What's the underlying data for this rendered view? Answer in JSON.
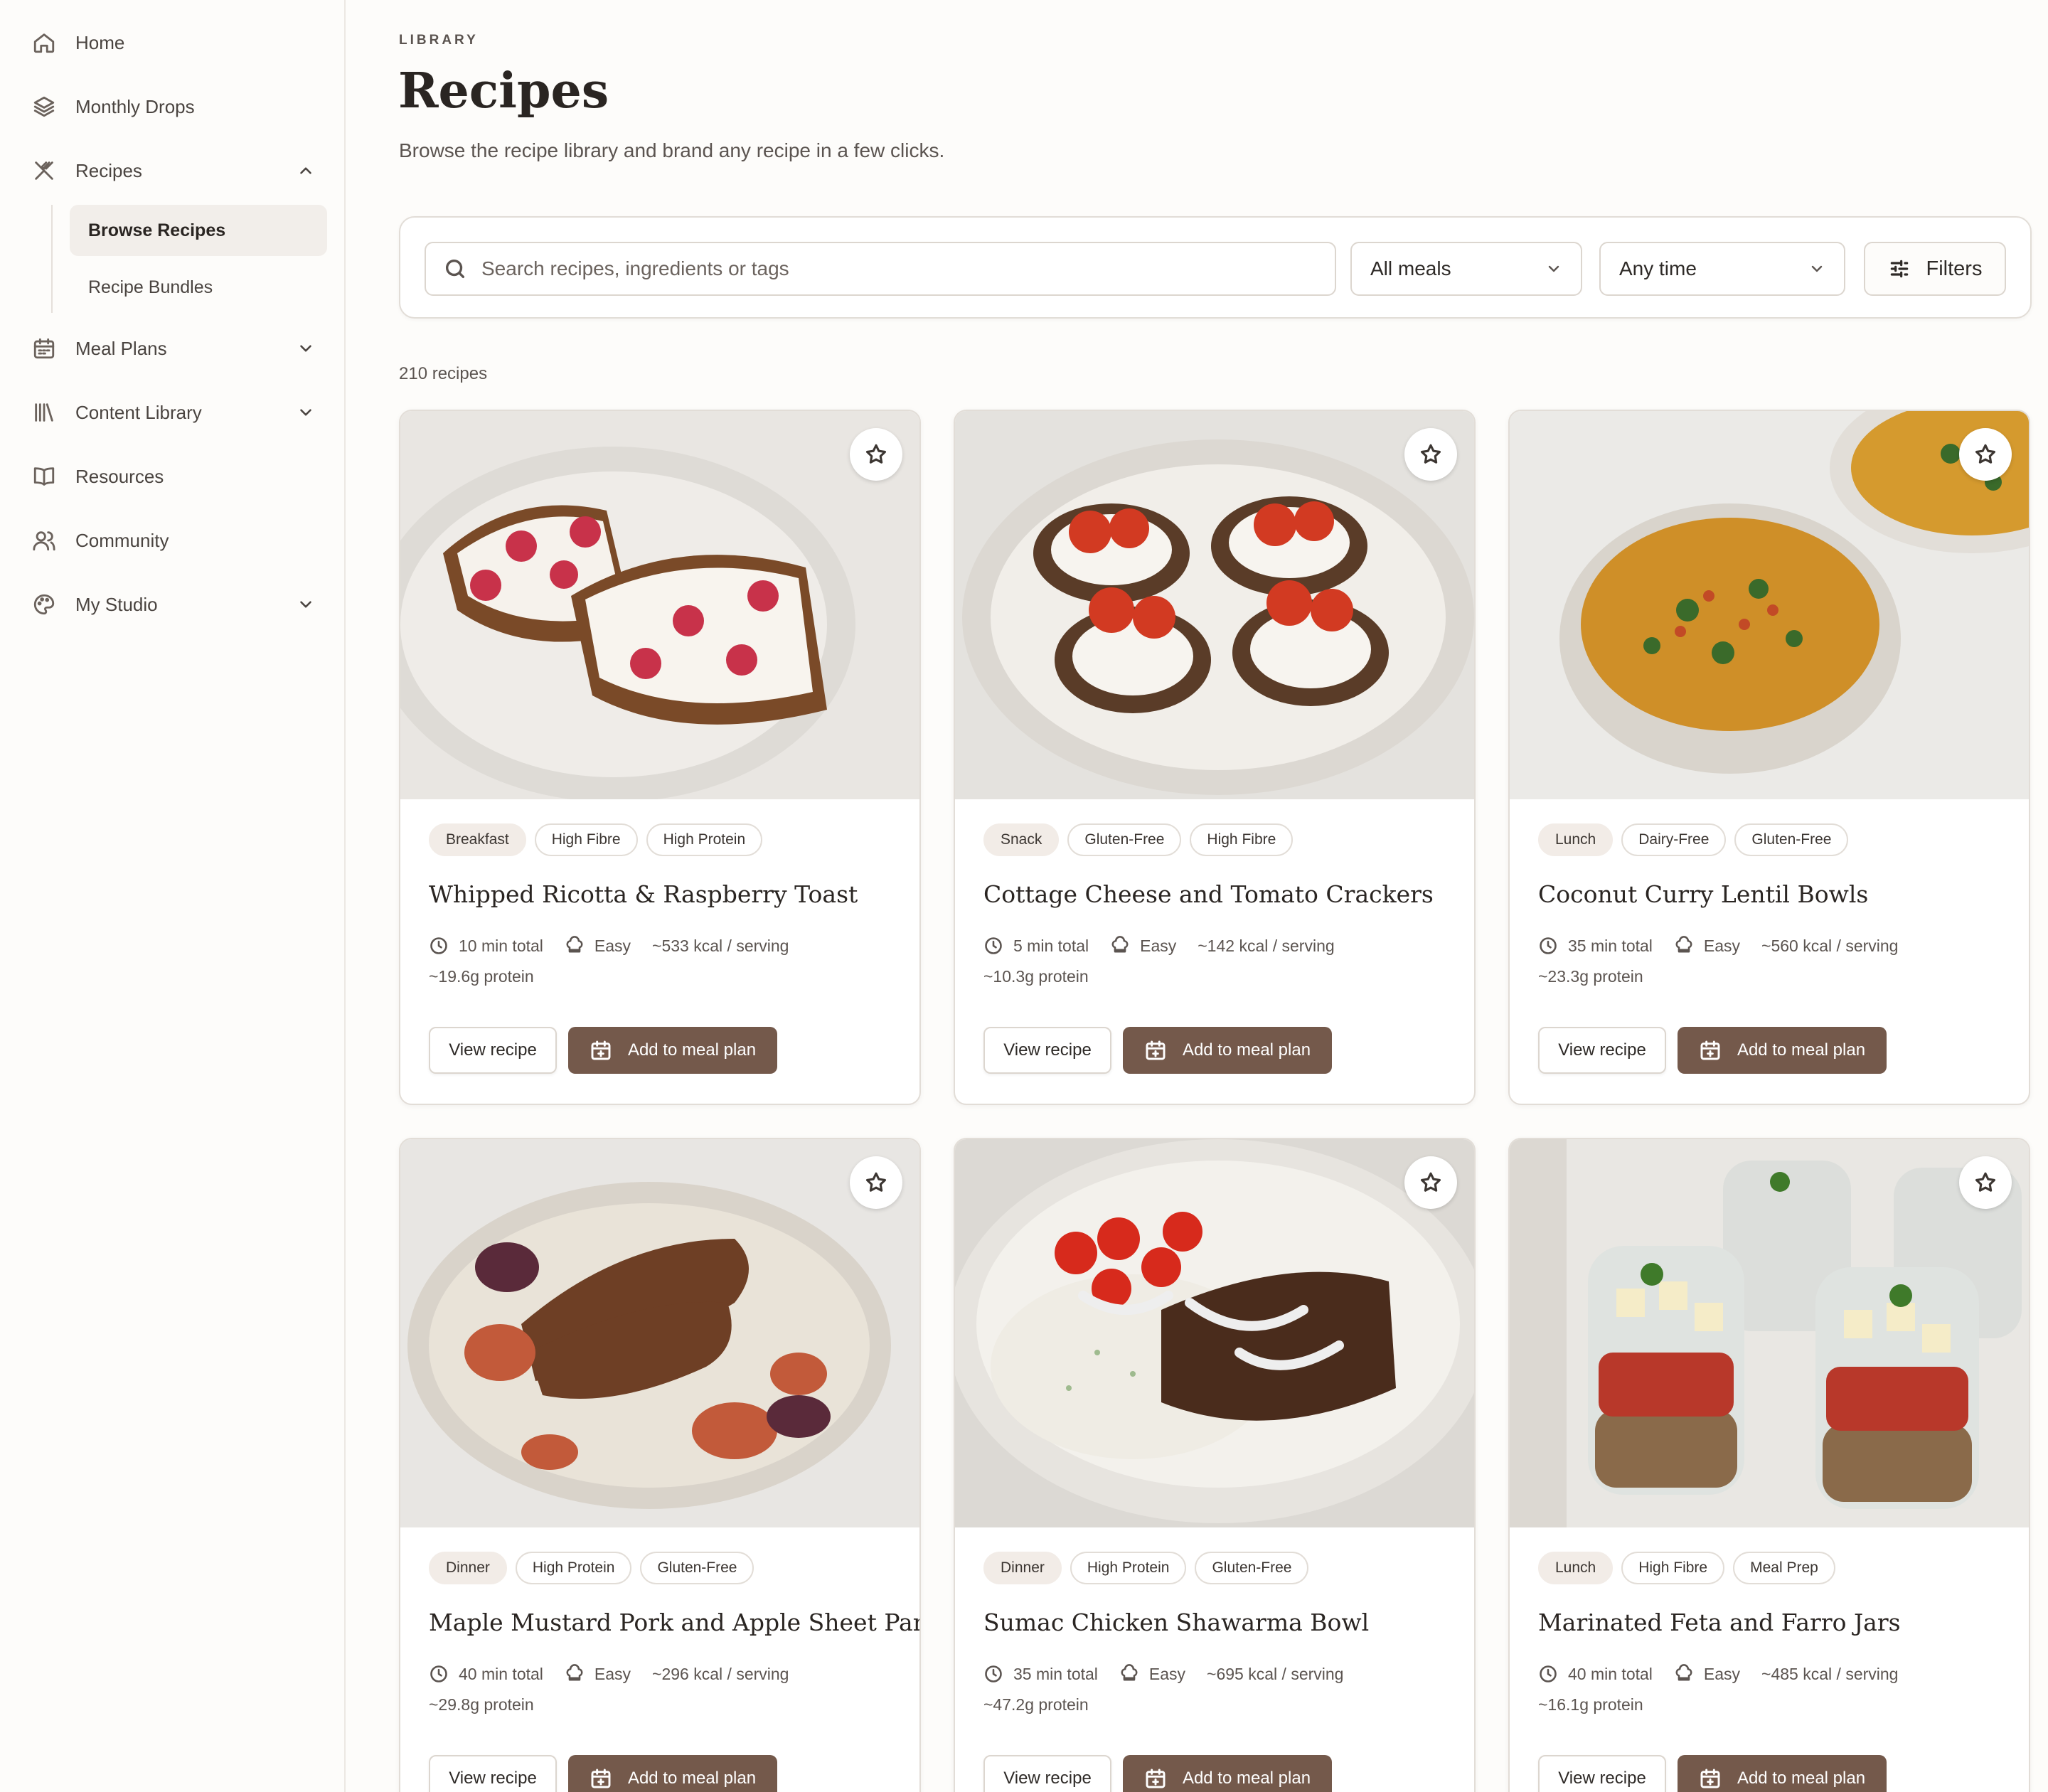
{
  "sidebar": {
    "items": [
      {
        "label": "Home",
        "icon": "home-icon"
      },
      {
        "label": "Monthly Drops",
        "icon": "layers-icon"
      },
      {
        "label": "Recipes",
        "icon": "utensils-icon",
        "expanded": true
      },
      {
        "label": "Meal Plans",
        "icon": "calendar-icon"
      },
      {
        "label": "Content Library",
        "icon": "library-icon"
      },
      {
        "label": "Resources",
        "icon": "book-icon"
      },
      {
        "label": "Community",
        "icon": "users-icon"
      },
      {
        "label": "My Studio",
        "icon": "palette-icon"
      }
    ],
    "recipes_sub": [
      {
        "label": "Browse Recipes",
        "active": true
      },
      {
        "label": "Recipe Bundles",
        "active": false
      }
    ]
  },
  "header": {
    "eyebrow": "LIBRARY",
    "title": "Recipes",
    "description": "Browse the recipe library and brand any recipe in a few clicks."
  },
  "filters": {
    "search_placeholder": "Search recipes, ingredients or tags",
    "meal_select": "All meals",
    "time_select": "Any time",
    "filters_label": "Filters"
  },
  "results_count": "210 recipes",
  "card_buttons": {
    "view": "View recipe",
    "add": "Add to meal plan"
  },
  "recipes": [
    {
      "title": "Whipped Ricotta & Raspberry Toast",
      "tags": [
        "Breakfast",
        "High Fibre",
        "High Protein"
      ],
      "time": "10 min total",
      "difficulty": "Easy",
      "kcal": "~533 kcal / serving",
      "protein": "~19.6g protein"
    },
    {
      "title": "Cottage Cheese and Tomato Crackers",
      "tags": [
        "Snack",
        "Gluten-Free",
        "High Fibre"
      ],
      "time": "5 min total",
      "difficulty": "Easy",
      "kcal": "~142 kcal / serving",
      "protein": "~10.3g protein"
    },
    {
      "title": "Coconut Curry Lentil Bowls",
      "tags": [
        "Lunch",
        "Dairy-Free",
        "Gluten-Free"
      ],
      "time": "35 min total",
      "difficulty": "Easy",
      "kcal": "~560 kcal / serving",
      "protein": "~23.3g protein"
    },
    {
      "title": "Maple Mustard Pork and Apple Sheet Pan",
      "tags": [
        "Dinner",
        "High Protein",
        "Gluten-Free"
      ],
      "time": "40 min total",
      "difficulty": "Easy",
      "kcal": "~296 kcal / serving",
      "protein": "~29.8g protein"
    },
    {
      "title": "Sumac Chicken Shawarma Bowl",
      "tags": [
        "Dinner",
        "High Protein",
        "Gluten-Free"
      ],
      "time": "35 min total",
      "difficulty": "Easy",
      "kcal": "~695 kcal / serving",
      "protein": "~47.2g protein"
    },
    {
      "title": "Marinated Feta and Farro Jars",
      "tags": [
        "Lunch",
        "High Fibre",
        "Meal Prep"
      ],
      "time": "40 min total",
      "difficulty": "Easy",
      "kcal": "~485 kcal / serving",
      "protein": "~16.1g protein"
    }
  ],
  "colors": {
    "accent": "#74594b",
    "background": "#fdfcfa",
    "border": "#e2ddd7"
  }
}
